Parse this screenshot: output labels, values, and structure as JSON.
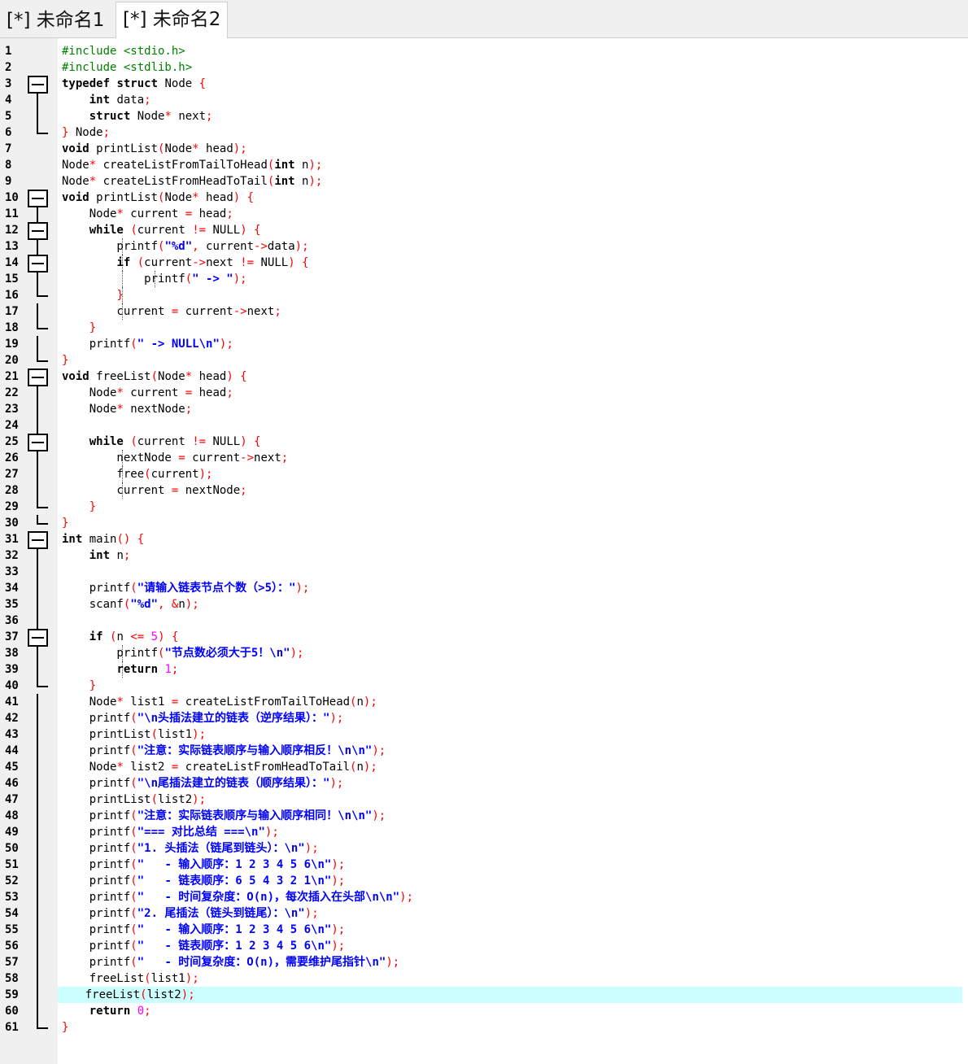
{
  "tabs": [
    {
      "label": "[*] 未命名1",
      "active": false
    },
    {
      "label": "[*] 未命名2",
      "active": true
    }
  ],
  "editor": {
    "highlighted_line": 59,
    "lines": [
      "#include <stdio.h>",
      "#include <stdlib.h>",
      "typedef struct Node {",
      "    int data;",
      "    struct Node* next;",
      "} Node;",
      "void printList(Node* head);",
      "Node* createListFromTailToHead(int n);",
      "Node* createListFromHeadToTail(int n);",
      "void printList(Node* head) {",
      "    Node* current = head;",
      "    while (current != NULL) {",
      "        printf(\"%d\", current->data);",
      "        if (current->next != NULL) {",
      "            printf(\" -> \");",
      "        }",
      "        current = current->next;",
      "    }",
      "    printf(\" -> NULL\\n\");",
      "}",
      "void freeList(Node* head) {",
      "    Node* current = head;",
      "    Node* nextNode;",
      "",
      "    while (current != NULL) {",
      "        nextNode = current->next;",
      "        free(current);",
      "        current = nextNode;",
      "    }",
      "}",
      "int main() {",
      "    int n;",
      "",
      "    printf(\"请输入链表节点个数（>5）：\");",
      "    scanf(\"%d\", &n);",
      "",
      "    if (n <= 5) {",
      "        printf(\"节点数必须大于5！\\n\");",
      "        return 1;",
      "    }",
      "    Node* list1 = createListFromTailToHead(n);",
      "    printf(\"\\n头插法建立的链表（逆序结果）：\");",
      "    printList(list1);",
      "    printf(\"注意：实际链表顺序与输入顺序相反！\\n\\n\");",
      "    Node* list2 = createListFromHeadToTail(n);",
      "    printf(\"\\n尾插法建立的链表（顺序结果）：\");",
      "    printList(list2);",
      "    printf(\"注意：实际链表顺序与输入顺序相同！\\n\\n\");",
      "    printf(\"=== 对比总结 ===\\n\");",
      "    printf(\"1. 头插法（链尾到链头）：\\n\");",
      "    printf(\"   - 输入顺序：1 2 3 4 5 6\\n\");",
      "    printf(\"   - 链表顺序：6 5 4 3 2 1\\n\");",
      "    printf(\"   - 时间复杂度：O(n)，每次插入在头部\\n\\n\");",
      "    printf(\"2. 尾插法（链头到链尾）：\\n\");",
      "    printf(\"   - 输入顺序：1 2 3 4 5 6\\n\");",
      "    printf(\"   - 链表顺序：1 2 3 4 5 6\\n\");",
      "    printf(\"   - 时间复杂度：O(n)，需要维护尾指针\\n\");",
      "    freeList(list1);",
      "    freeList(list2);",
      "    return 0;",
      "}"
    ]
  }
}
